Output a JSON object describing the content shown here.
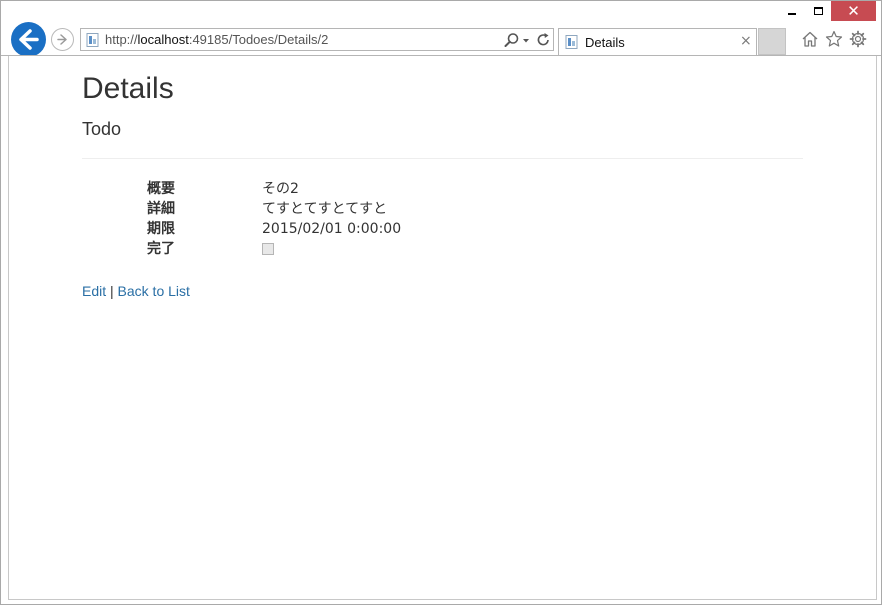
{
  "browser": {
    "url_prefix": "http://",
    "url_host": "localhost",
    "url_rest": ":49185/Todoes/Details/2",
    "tab_title": "Details",
    "tab_close": "×",
    "close_glyph": "✕"
  },
  "page": {
    "title": "Details",
    "subtitle": "Todo",
    "fields": [
      {
        "label": "概要",
        "value": "その2"
      },
      {
        "label": "詳細",
        "value": "てすとてすとてすと"
      },
      {
        "label": "期限",
        "value": "2015/02/01 0:00:00"
      },
      {
        "label": "完了",
        "checked": false
      }
    ],
    "links": {
      "edit": "Edit",
      "separator": "|",
      "back": "Back to List"
    }
  },
  "colors": {
    "link": "#2a6fa5",
    "close_button": "#c74b52",
    "back_button": "#1a6fc4"
  }
}
